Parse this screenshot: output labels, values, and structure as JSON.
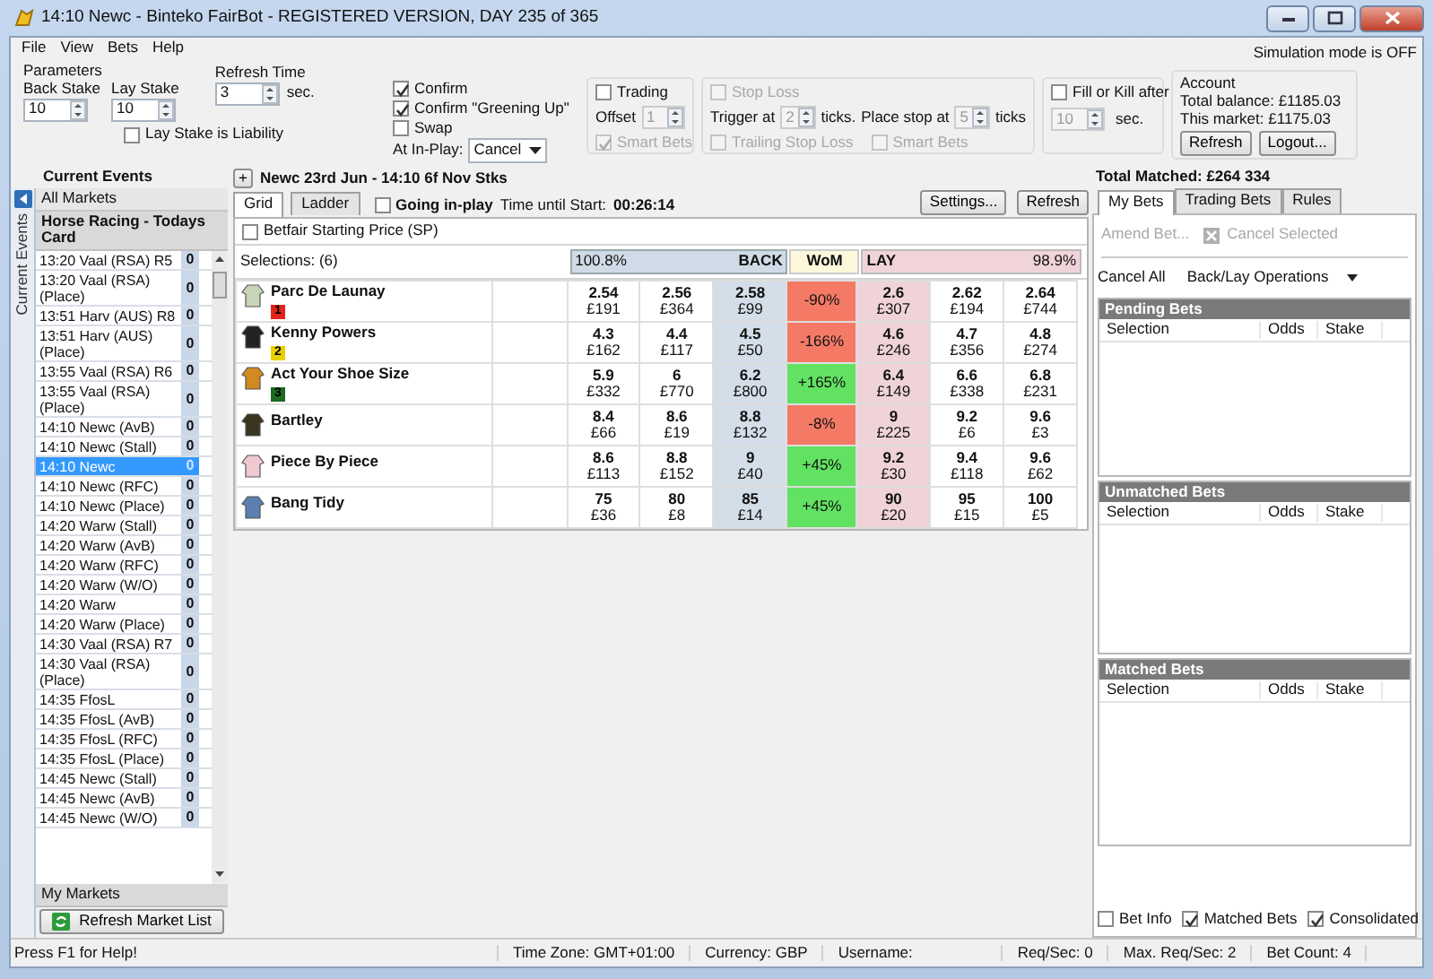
{
  "window": {
    "title": "14:10 Newc - Binteko FairBot - REGISTERED VERSION, DAY 235 of 365"
  },
  "menu": [
    "File",
    "View",
    "Bets",
    "Help"
  ],
  "simulation_mode": "Simulation mode is OFF",
  "parameters": {
    "title": "Parameters",
    "back_stake": {
      "label": "Back Stake",
      "value": "10"
    },
    "lay_stake": {
      "label": "Lay Stake",
      "value": "10"
    },
    "lay_stake_is_liability": {
      "label": "Lay Stake is Liability",
      "checked": false
    },
    "refresh_time": {
      "label": "Refresh Time",
      "value": "3",
      "unit": "sec."
    }
  },
  "confirm_options": [
    {
      "label": "Confirm",
      "checked": true
    },
    {
      "label": "Confirm \"Greening Up\"",
      "checked": true
    },
    {
      "label": "Swap",
      "checked": false
    }
  ],
  "at_in_play": {
    "label": "At In-Play:",
    "value": "Cancel"
  },
  "trading": {
    "label": "Trading",
    "checked": false,
    "offset_label": "Offset",
    "offset_value": "1",
    "disabled": true,
    "smart_bets": {
      "label": "Smart Bets",
      "checked": true
    }
  },
  "stop_loss": {
    "label": "Stop Loss",
    "checked": false,
    "disabled": true,
    "trigger_label": "Trigger at",
    "trigger_value": "2",
    "ticks_label": "ticks.",
    "place_label": "Place stop at",
    "place_value": "5",
    "place_unit": "ticks",
    "trailing": {
      "label": "Trailing Stop Loss",
      "checked": false
    },
    "smart_bets": {
      "label": "Smart Bets",
      "checked": false
    }
  },
  "fill_or_kill": {
    "label": "Fill or Kill after",
    "checked": false,
    "value": "10",
    "unit": "sec.",
    "disabled": true
  },
  "account": {
    "title": "Account",
    "total_balance": "Total balance: £1185.03",
    "this_market": "This market: £1175.03",
    "buttons": [
      "Refresh",
      "Logout..."
    ]
  },
  "current_events": {
    "title": "Current Events",
    "side_tab": "Current Events",
    "all_markets": "All Markets",
    "category": "Horse Racing - Todays Card",
    "markets": [
      {
        "name": "13:20 Vaal (RSA)  R5",
        "count": "0",
        "selected": false
      },
      {
        "name": "13:20 Vaal (RSA) (Place)",
        "count": "0",
        "selected": false
      },
      {
        "name": "13:51 Harv (AUS)  R8",
        "count": "0",
        "selected": false
      },
      {
        "name": "13:51 Harv (AUS) (Place)",
        "count": "0",
        "selected": false
      },
      {
        "name": "13:55 Vaal (RSA)  R6",
        "count": "0",
        "selected": false
      },
      {
        "name": "13:55 Vaal (RSA) (Place)",
        "count": "0",
        "selected": false
      },
      {
        "name": "14:10 Newc (AvB)",
        "count": "0",
        "selected": false
      },
      {
        "name": "14:10 Newc (Stall)",
        "count": "0",
        "selected": false
      },
      {
        "name": "14:10 Newc",
        "count": "0",
        "selected": true
      },
      {
        "name": "14:10 Newc (RFC)",
        "count": "0",
        "selected": false
      },
      {
        "name": "14:10 Newc  (Place)",
        "count": "0",
        "selected": false
      },
      {
        "name": "14:20 Warw (Stall)",
        "count": "0",
        "selected": false
      },
      {
        "name": "14:20 Warw (AvB)",
        "count": "0",
        "selected": false
      },
      {
        "name": "14:20 Warw (RFC)",
        "count": "0",
        "selected": false
      },
      {
        "name": "14:20 Warw (W/O)",
        "count": "0",
        "selected": false
      },
      {
        "name": "14:20 Warw",
        "count": "0",
        "selected": false
      },
      {
        "name": "14:20 Warw  (Place)",
        "count": "0",
        "selected": false
      },
      {
        "name": "14:30 Vaal (RSA)  R7",
        "count": "0",
        "selected": false
      },
      {
        "name": "14:30 Vaal (RSA) (Place)",
        "count": "0",
        "selected": false
      },
      {
        "name": "14:35 FfosL",
        "count": "0",
        "selected": false
      },
      {
        "name": "14:35 FfosL (AvB)",
        "count": "0",
        "selected": false
      },
      {
        "name": "14:35 FfosL (RFC)",
        "count": "0",
        "selected": false
      },
      {
        "name": "14:35 FfosL  (Place)",
        "count": "0",
        "selected": false
      },
      {
        "name": "14:45 Newc (Stall)",
        "count": "0",
        "selected": false
      },
      {
        "name": "14:45 Newc (AvB)",
        "count": "0",
        "selected": false
      },
      {
        "name": "14:45 Newc (W/O)",
        "count": "0",
        "selected": false
      }
    ],
    "my_markets": "My Markets",
    "refresh_button": "Refresh Market List"
  },
  "market": {
    "expand_button": "+",
    "title": "Newc 23rd Jun - 14:10 6f Nov Stks",
    "tabs": [
      {
        "label": "Grid",
        "selected": true
      },
      {
        "label": "Ladder",
        "selected": false
      }
    ],
    "going_in_play": {
      "label": "Going in-play",
      "checked": false
    },
    "time_label": "Time until Start:",
    "time_value": "00:26:14",
    "buttons": [
      "Settings...",
      "Refresh"
    ],
    "sp": {
      "label": "Betfair Starting Price (SP)",
      "checked": false
    },
    "selections": "Selections: (6)",
    "back_percent": "100.8%",
    "back_label": "BACK",
    "wom_label": "WoM",
    "lay_label": "LAY",
    "lay_percent": "98.9%",
    "runners": [
      {
        "name": "Parc De Launay",
        "silk": {
          "color": "#c8d4b8"
        },
        "cloth": {
          "text": "1",
          "color": "#e02418"
        },
        "back": [
          [
            "2.54",
            "£191"
          ],
          [
            "2.56",
            "£364"
          ],
          [
            "2.58",
            "£99"
          ]
        ],
        "wom": {
          "text": "-90%",
          "kind": "negative"
        },
        "lay": [
          [
            "2.6",
            "£307"
          ],
          [
            "2.62",
            "£194"
          ],
          [
            "2.64",
            "£744"
          ]
        ]
      },
      {
        "name": "Kenny Powers",
        "silk": {
          "color": "#222222"
        },
        "cloth": {
          "text": "2",
          "color": "#e8d000"
        },
        "back": [
          [
            "4.3",
            "£162"
          ],
          [
            "4.4",
            "£117"
          ],
          [
            "4.5",
            "£50"
          ]
        ],
        "wom": {
          "text": "-166%",
          "kind": "negative"
        },
        "lay": [
          [
            "4.6",
            "£246"
          ],
          [
            "4.7",
            "£356"
          ],
          [
            "4.8",
            "£274"
          ]
        ]
      },
      {
        "name": "Act Your Shoe Size",
        "silk": {
          "color": "#d08a20"
        },
        "cloth": {
          "text": "3",
          "color": "#1a6a20"
        },
        "back": [
          [
            "5.9",
            "£332"
          ],
          [
            "6",
            "£770"
          ],
          [
            "6.2",
            "£800"
          ]
        ],
        "wom": {
          "text": "+165%",
          "kind": "positive"
        },
        "lay": [
          [
            "6.4",
            "£149"
          ],
          [
            "6.6",
            "£338"
          ],
          [
            "6.8",
            "£231"
          ]
        ]
      },
      {
        "name": "Bartley",
        "silk": {
          "color": "#3a3520"
        },
        "back": [
          [
            "8.4",
            "£66"
          ],
          [
            "8.6",
            "£19"
          ],
          [
            "8.8",
            "£132"
          ]
        ],
        "wom": {
          "text": "-8%",
          "kind": "negative"
        },
        "lay": [
          [
            "9",
            "£225"
          ],
          [
            "9.2",
            "£6"
          ],
          [
            "9.6",
            "£3"
          ]
        ]
      },
      {
        "name": "Piece By Piece",
        "silk": {
          "color": "#f0c8d0"
        },
        "back": [
          [
            "8.6",
            "£113"
          ],
          [
            "8.8",
            "£152"
          ],
          [
            "9",
            "£40"
          ]
        ],
        "wom": {
          "text": "+45%",
          "kind": "positive"
        },
        "lay": [
          [
            "9.2",
            "£30"
          ],
          [
            "9.4",
            "£118"
          ],
          [
            "9.6",
            "£62"
          ]
        ]
      },
      {
        "name": "Bang Tidy",
        "silk": {
          "color": "#5b7fb0"
        },
        "back": [
          [
            "75",
            "£36"
          ],
          [
            "80",
            "£8"
          ],
          [
            "85",
            "£14"
          ]
        ],
        "wom": {
          "text": "+45%",
          "kind": "positive"
        },
        "lay": [
          [
            "90",
            "£20"
          ],
          [
            "95",
            "£15"
          ],
          [
            "100",
            "£5"
          ]
        ]
      }
    ]
  },
  "bets_panel": {
    "total_matched": "Total Matched: £264 334",
    "tabs": [
      {
        "label": "My Bets",
        "selected": true
      },
      {
        "label": "Trading Bets",
        "selected": false
      },
      {
        "label": "Rules",
        "selected": false
      }
    ],
    "toolbar": [
      {
        "label": "Amend Bet...",
        "disabled": true
      },
      {
        "label": "Cancel Selected",
        "disabled": true,
        "kind": "icon"
      }
    ],
    "cancel_all": "Cancel All",
    "operations": "Back/Lay Operations",
    "sections": [
      {
        "title": "Pending Bets",
        "columns": [
          "Selection",
          "Odds",
          "Stake"
        ]
      },
      {
        "title": "Unmatched Bets",
        "columns": [
          "Selection",
          "Odds",
          "Stake"
        ]
      },
      {
        "title": "Matched Bets",
        "columns": [
          "Selection",
          "Odds",
          "Stake"
        ]
      }
    ],
    "options": [
      {
        "label": "Bet Info",
        "checked": false
      },
      {
        "label": "Matched Bets",
        "checked": true
      },
      {
        "label": "Consolidated",
        "checked": true
      }
    ]
  },
  "status_bar": [
    "Press F1 for Help!",
    "Time Zone: GMT+01:00",
    "Currency: GBP",
    "Username:",
    "Req/Sec: 0",
    "Max. Req/Sec: 2",
    "Bet Count: 4"
  ]
}
